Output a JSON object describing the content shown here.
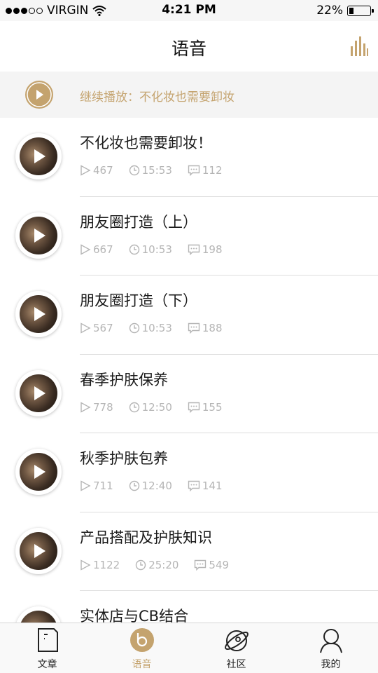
{
  "status_bar": {
    "carrier": "VIRGIN",
    "time": "4:21 PM",
    "battery": "22%",
    "battery_level": 0.22,
    "signal_bars": 3
  },
  "header": {
    "title": "语音",
    "right_icon": "audio-bars-icon"
  },
  "resume": {
    "label": "继续播放：不化妆也需要卸妆"
  },
  "list": [
    {
      "title": "不化妆也需要卸妆！",
      "plays": "467",
      "duration": "15:53",
      "comments": "112"
    },
    {
      "title": "朋友圈打造（上）",
      "plays": "667",
      "duration": "10:53",
      "comments": "198"
    },
    {
      "title": "朋友圈打造（下）",
      "plays": "567",
      "duration": "10:53",
      "comments": "188"
    },
    {
      "title": "春季护肤保养",
      "plays": "778",
      "duration": "12:50",
      "comments": "155"
    },
    {
      "title": "秋季护肤包养",
      "plays": "711",
      "duration": "12:40",
      "comments": "141"
    },
    {
      "title": "产品搭配及护肤知识",
      "plays": "1122",
      "duration": "25:20",
      "comments": "549"
    },
    {
      "title": "实体店与CB结合",
      "plays": "",
      "duration": "",
      "comments": ""
    }
  ],
  "tabs": [
    {
      "label": "文章",
      "icon": "article-icon"
    },
    {
      "label": "语音",
      "icon": "voice-icon",
      "active": true
    },
    {
      "label": "社区",
      "icon": "community-planet-icon"
    },
    {
      "label": "我的",
      "icon": "profile-icon"
    }
  ],
  "colors": {
    "accent": "#c4a36e",
    "muted": "#b5b5b5",
    "separator": "#dddddd"
  }
}
